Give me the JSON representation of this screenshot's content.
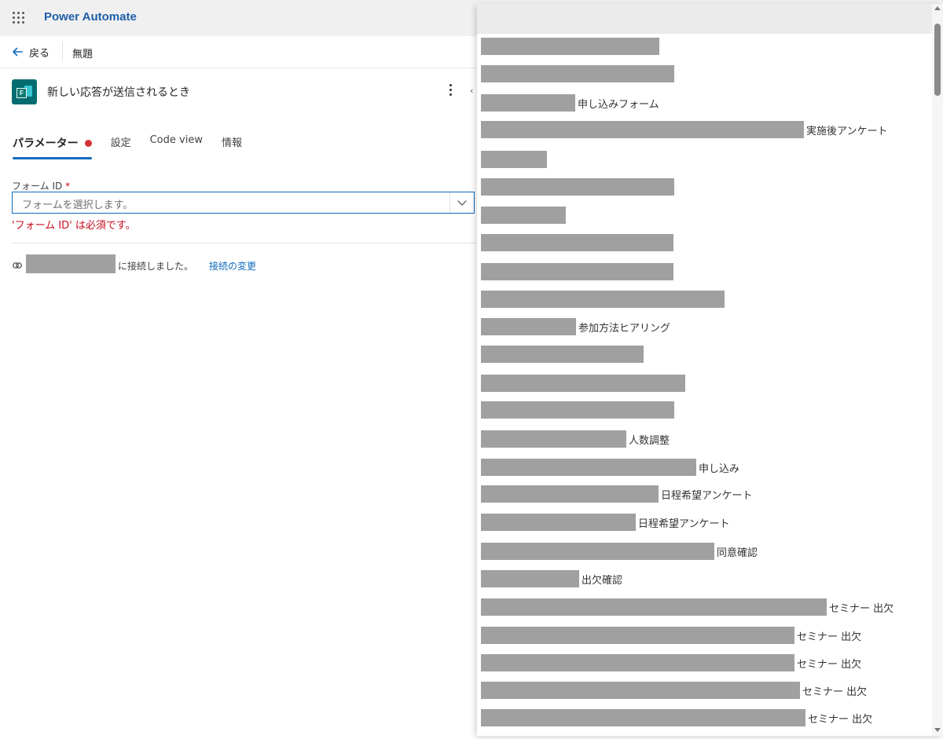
{
  "app": {
    "title": "Power Automate"
  },
  "command_bar": {
    "back_label": "戻る",
    "flow_name": "無題"
  },
  "trigger": {
    "title": "新しい応答が送信されるとき"
  },
  "tabs": [
    {
      "label": "パラメーター",
      "active": true,
      "error": true
    },
    {
      "label": "設定",
      "active": false
    },
    {
      "label": "Code view",
      "active": false
    },
    {
      "label": "情報",
      "active": false
    }
  ],
  "form_field": {
    "label": "フォーム ID",
    "required_mark": "*",
    "placeholder": "フォームを選択します。",
    "error": "'フォーム ID' は必須です。"
  },
  "connection": {
    "text": "に接続しました。",
    "change_link": "接続の変更"
  },
  "dropdown": {
    "options": [
      {
        "suffix": "",
        "redacted": true
      },
      {
        "suffix": "",
        "redacted": true
      },
      {
        "suffix": "申し込みフォーム",
        "redacted": true
      },
      {
        "suffix": "実施後アンケート",
        "redacted": true
      },
      {
        "suffix": "",
        "redacted": true
      },
      {
        "suffix": "",
        "redacted": true
      },
      {
        "suffix": "",
        "redacted": true
      },
      {
        "suffix": "",
        "redacted": true
      },
      {
        "suffix": "",
        "redacted": true
      },
      {
        "suffix": "",
        "redacted": true
      },
      {
        "suffix": "参加方法ヒアリング",
        "redacted": true
      },
      {
        "suffix": "",
        "redacted": true
      },
      {
        "suffix": "",
        "redacted": true
      },
      {
        "suffix": "",
        "redacted": true
      },
      {
        "suffix": "人数調整",
        "redacted": true
      },
      {
        "suffix": "申し込み",
        "redacted": true
      },
      {
        "suffix": "日程希望アンケート",
        "redacted": true
      },
      {
        "suffix": "日程希望アンケート",
        "redacted": true
      },
      {
        "suffix": "同意確認",
        "redacted": true
      },
      {
        "suffix": "出欠確認",
        "redacted": true
      },
      {
        "suffix": "セミナー 出欠",
        "redacted": true
      },
      {
        "suffix": "セミナー 出欠",
        "redacted": true
      },
      {
        "suffix": "セミナー 出欠",
        "redacted": true
      },
      {
        "suffix": "セミナー 出欠",
        "redacted": true
      },
      {
        "suffix": "セミナー 出欠",
        "redacted": true
      }
    ]
  },
  "colors": {
    "accent": "#0f6cbd",
    "error": "#c50f1f",
    "brand_title": "#1f5ea8",
    "redaction": "#a0a0a0"
  }
}
